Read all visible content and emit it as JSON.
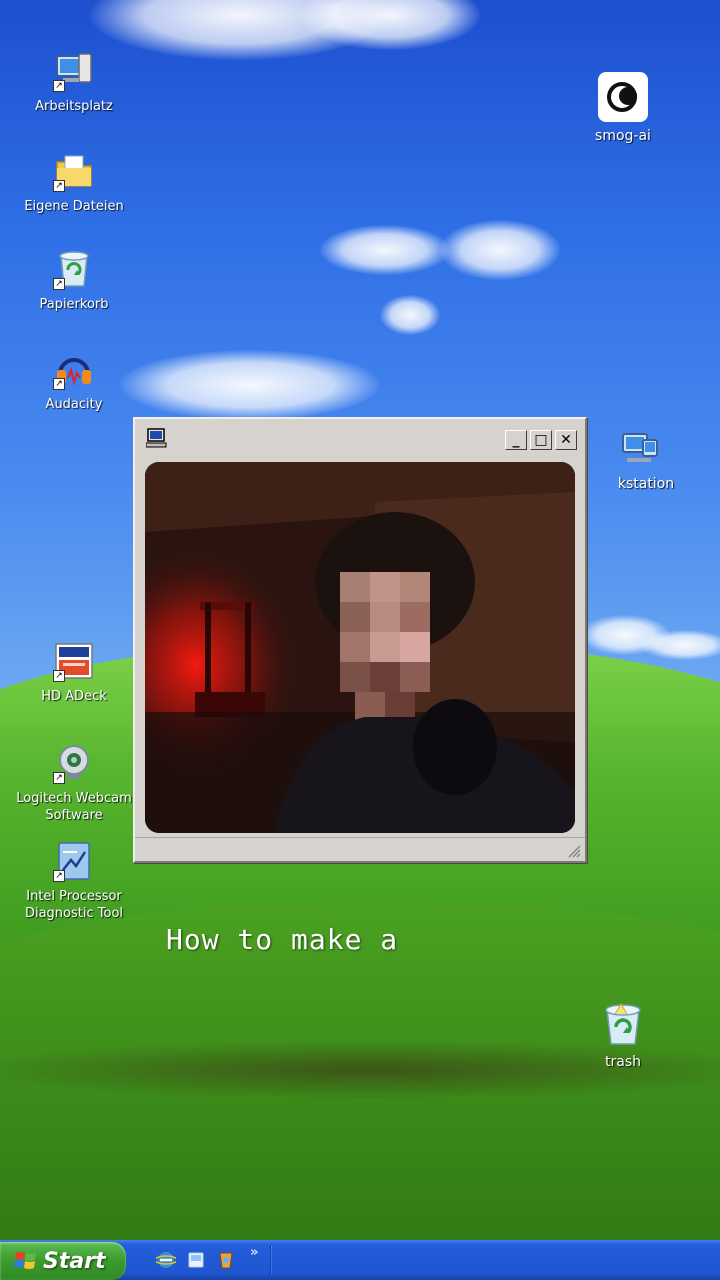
{
  "desktop": {
    "icons_left": [
      {
        "label": "Arbeitsplatz"
      },
      {
        "label": "Eigene Dateien"
      },
      {
        "label": "Papierkorb"
      },
      {
        "label": "Audacity"
      },
      {
        "label": "HD ADeck"
      },
      {
        "label": "Logitech Webcam Software"
      },
      {
        "label": "Intel Processor Diagnostic Tool"
      }
    ],
    "icons_right": [
      {
        "label": "smog-ai"
      },
      {
        "label": "kstation"
      },
      {
        "label": "trash"
      }
    ]
  },
  "window": {
    "buttons": {
      "minimize": "_",
      "maximize": "□",
      "close": "✕"
    }
  },
  "caption": "How to make a",
  "taskbar": {
    "start_label": "Start",
    "quicklaunch_more": "»"
  },
  "colors": {
    "start_green": "#3c9a2e",
    "taskbar_blue": "#245edb",
    "window_face": "#d6d3ce"
  }
}
